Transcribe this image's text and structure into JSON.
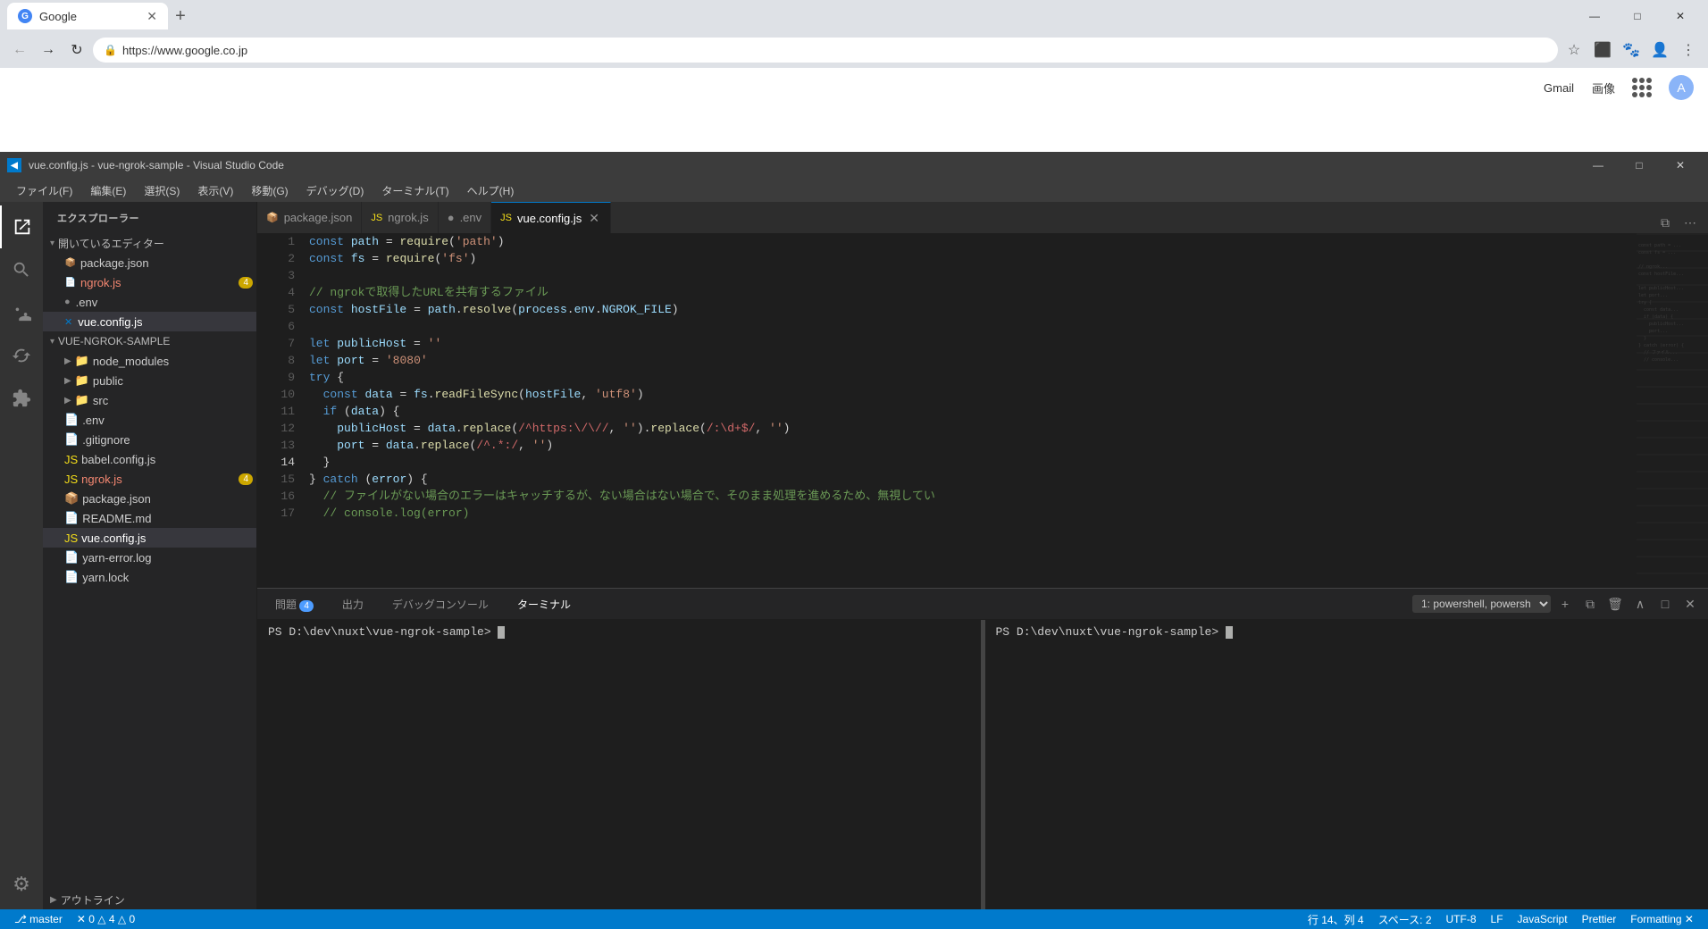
{
  "chrome": {
    "tab_title": "Google",
    "tab_favicon": "G",
    "url": "https://www.google.co.jp",
    "gmail_label": "Gmail",
    "images_label": "画像",
    "window_controls": [
      "—",
      "□",
      "✕"
    ],
    "google_links": [
      "Gmail",
      "画像"
    ]
  },
  "vscode": {
    "title": "vue.config.js - vue-ngrok-sample - Visual Studio Code",
    "title_icon": "VS",
    "menu_items": [
      "ファイル(F)",
      "編集(E)",
      "選択(S)",
      "表示(V)",
      "移動(G)",
      "デバッグ(D)",
      "ターミナル(T)",
      "ヘルプ(H)"
    ],
    "sidebar_title": "エクスプローラー",
    "open_editors_title": "開いているエディター",
    "project_title": "VUE-NGROK-SAMPLE",
    "files": [
      {
        "name": "package.json",
        "indent": 2,
        "icon": "📄"
      },
      {
        "name": "ngrok.js",
        "indent": 2,
        "icon": "📄",
        "badge": "4"
      },
      {
        "name": ".env",
        "indent": 2,
        "icon": "📄"
      },
      {
        "name": "vue.config.js",
        "indent": 2,
        "icon": "📄",
        "active": true
      }
    ],
    "project_items": [
      {
        "name": "node_modules",
        "indent": 1,
        "type": "folder"
      },
      {
        "name": "public",
        "indent": 1,
        "type": "folder"
      },
      {
        "name": "src",
        "indent": 1,
        "type": "folder"
      },
      {
        "name": ".env",
        "indent": 1,
        "icon": "📄"
      },
      {
        "name": ".gitignore",
        "indent": 1,
        "icon": "📄"
      },
      {
        "name": "babel.config.js",
        "indent": 1,
        "icon": "📄"
      },
      {
        "name": "ngrok.js",
        "indent": 1,
        "icon": "📄",
        "badge": "4"
      },
      {
        "name": "package.json",
        "indent": 1,
        "icon": "📄"
      },
      {
        "name": "README.md",
        "indent": 1,
        "icon": "📄"
      },
      {
        "name": "vue.config.js",
        "indent": 1,
        "icon": "📄",
        "active": true
      },
      {
        "name": "yarn-error.log",
        "indent": 1,
        "icon": "📄"
      },
      {
        "name": "yarn.lock",
        "indent": 1,
        "icon": "📄"
      }
    ],
    "tabs": [
      {
        "name": "package.json",
        "icon": "📦",
        "active": false
      },
      {
        "name": "ngrok.js",
        "icon": "📄",
        "modified": false,
        "active": false
      },
      {
        "name": ".env",
        "icon": "📄",
        "active": false,
        "dot": true
      },
      {
        "name": "vue.config.js",
        "icon": "📄",
        "active": true,
        "close": true
      }
    ],
    "code_lines": [
      {
        "num": 1,
        "text": "const path = require('path')"
      },
      {
        "num": 2,
        "text": "const fs = require('fs')"
      },
      {
        "num": 3,
        "text": ""
      },
      {
        "num": 4,
        "text": "// ngrokで取得したURLを共有するファイル"
      },
      {
        "num": 5,
        "text": "const hostFile = path.resolve(process.env.NGROK_FILE)"
      },
      {
        "num": 6,
        "text": ""
      },
      {
        "num": 7,
        "text": "let publicHost = ''"
      },
      {
        "num": 8,
        "text": "let port = '8080'"
      },
      {
        "num": 9,
        "text": "try {"
      },
      {
        "num": 10,
        "text": "  const data = fs.readFileSync(hostFile, 'utf8')"
      },
      {
        "num": 11,
        "text": "  if (data) {"
      },
      {
        "num": 12,
        "text": "    publicHost = data.replace(/^https:\\/\\//,  '').replace(/:\\d+$/, '')"
      },
      {
        "num": 13,
        "text": "    port = data.replace(/^.*:/, '')"
      },
      {
        "num": 14,
        "text": "  }"
      },
      {
        "num": 15,
        "text": "} catch (error) {"
      },
      {
        "num": 16,
        "text": "  // ファイルがない場合のエラーはキャッチするが、ない場合はない場合で、そのまま処理を進めるため、無視してい"
      },
      {
        "num": 17,
        "text": "  // console.log(error)"
      }
    ],
    "terminal_tabs": [
      "問題",
      "出力",
      "デバッグコンソール",
      "ターミナル"
    ],
    "terminal_tab_badges": {
      "問題": "4"
    },
    "terminal_select": "1: powershell, powersh",
    "terminal1_prompt": "PS D:\\dev\\nuxt\\vue-ngrok-sample> |",
    "terminal2_prompt": "PS D:\\dev\\nuxt\\vue-ngrok-sample> |",
    "status_bar": {
      "branch": "⎇ master",
      "errors": "✕ 0 △ 4 △ 0",
      "row_col": "行 14、列 4",
      "spaces": "スペース: 2",
      "encoding": "UTF-8",
      "line_ending": "LF",
      "language": "JavaScript",
      "formatter": "Prettier",
      "formatting": "Formatting: ✕"
    },
    "actline": "アウトライン"
  }
}
